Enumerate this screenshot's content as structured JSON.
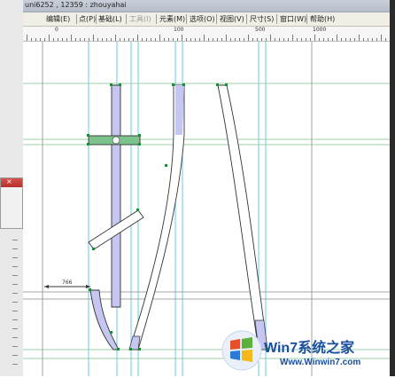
{
  "window": {
    "title": "uni6252 , 12359 : zhouyahai"
  },
  "menu": [
    {
      "label": "编辑(E)",
      "enabled": true
    },
    {
      "label": "点(P)",
      "enabled": true
    },
    {
      "label": "基础(L)",
      "enabled": true
    },
    {
      "label": "工具(I)",
      "enabled": false
    },
    {
      "label": "元素(M)",
      "enabled": true
    },
    {
      "label": "选项(O)",
      "enabled": true
    },
    {
      "label": "视图(V)",
      "enabled": true
    },
    {
      "label": "尺寸(S)",
      "enabled": true
    },
    {
      "label": "窗口(W)",
      "enabled": true
    },
    {
      "label": "帮助(H)",
      "enabled": true
    }
  ],
  "ruler": {
    "labels": [
      "0",
      "100",
      "500",
      "1000"
    ]
  },
  "canvas": {
    "dimension_label": "766",
    "guide_color": "#2ab8d8",
    "selection_fill": "#c5c6f2",
    "grid_color": "#7bc28c"
  },
  "watermark": {
    "brand": "Win7系统之家",
    "url": "Www.Winwin7.com"
  }
}
